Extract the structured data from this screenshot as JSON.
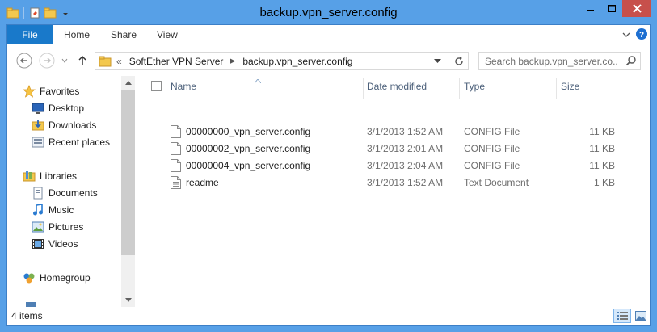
{
  "window": {
    "title": "backup.vpn_server.config",
    "min_label": "–",
    "max_label": "☐",
    "close_label": "✕"
  },
  "ribbon": {
    "file_tab": "File",
    "tabs": [
      "Home",
      "Share",
      "View"
    ]
  },
  "address": {
    "prefix": "«",
    "crumbs": [
      "SoftEther VPN Server",
      "backup.vpn_server.config"
    ]
  },
  "search": {
    "placeholder": "Search backup.vpn_server.co..."
  },
  "nav": {
    "groups": [
      {
        "label": "Favorites",
        "icon": "star-icon"
      },
      {
        "label": "Desktop",
        "icon": "desktop-icon"
      },
      {
        "label": "Downloads",
        "icon": "downloads-icon"
      },
      {
        "label": "Recent places",
        "icon": "recent-places-icon"
      },
      {
        "label": "Libraries",
        "icon": "libraries-icon"
      },
      {
        "label": "Documents",
        "icon": "documents-icon"
      },
      {
        "label": "Music",
        "icon": "music-icon"
      },
      {
        "label": "Pictures",
        "icon": "pictures-icon"
      },
      {
        "label": "Videos",
        "icon": "videos-icon"
      },
      {
        "label": "Homegroup",
        "icon": "homegroup-icon"
      }
    ]
  },
  "columns": {
    "name": "Name",
    "date": "Date modified",
    "type": "Type",
    "size": "Size"
  },
  "files": [
    {
      "name": "00000000_vpn_server.config",
      "date": "3/1/2013 1:52 AM",
      "type": "CONFIG File",
      "size": "11 KB"
    },
    {
      "name": "00000002_vpn_server.config",
      "date": "3/1/2013 2:01 AM",
      "type": "CONFIG File",
      "size": "11 KB"
    },
    {
      "name": "00000004_vpn_server.config",
      "date": "3/1/2013 2:04 AM",
      "type": "CONFIG File",
      "size": "11 KB"
    },
    {
      "name": "readme",
      "date": "3/1/2013 1:52 AM",
      "type": "Text Document",
      "size": "1 KB"
    }
  ],
  "status": {
    "count": "4 items"
  },
  "colors": {
    "frame": "#57a0e7",
    "file_tab": "#1979ca",
    "close_button": "#c7504b"
  }
}
